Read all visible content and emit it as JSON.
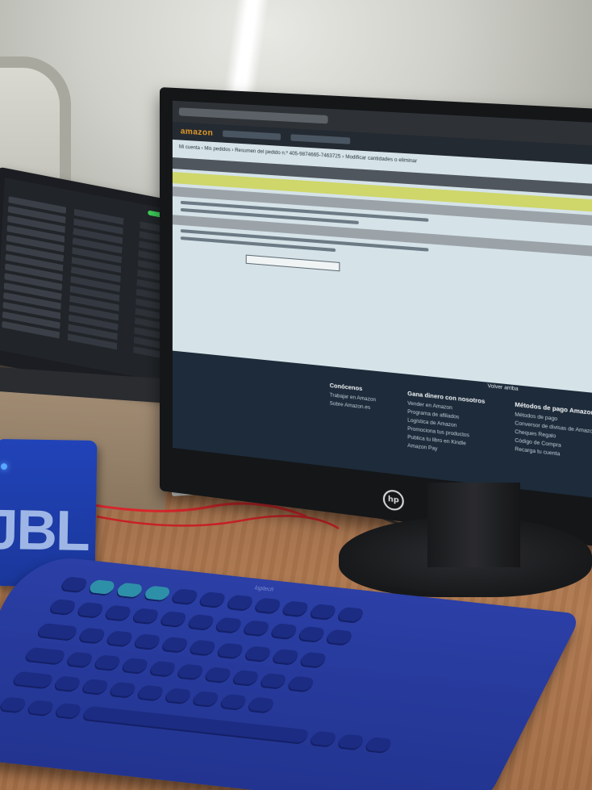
{
  "monitor": {
    "site_brand": "amazon",
    "breadcrumb": "Mi cuenta › Mis pedidos › Resumen del pedido n.º 405-9874665-7463725 › Modificar cantidades o eliminar",
    "back_to_top": "Volver arriba",
    "footer": {
      "columns": [
        {
          "heading": "Conócenos",
          "links": [
            "Trabajar en Amazon",
            "Sobre Amazon.es"
          ]
        },
        {
          "heading": "Gana dinero con nosotros",
          "links": [
            "Vender en Amazon",
            "Programa de afiliados",
            "Logística de Amazon",
            "Promociona tus productos",
            "Publica tu libro en Kindle",
            "Amazon Pay"
          ]
        },
        {
          "heading": "Métodos de pago Amazon",
          "links": [
            "Métodos de pago",
            "Conversor de divisas de Amazon",
            "Cheques Regalo",
            "Código de Compra",
            "Recarga tu cuenta"
          ]
        }
      ]
    },
    "hardware_logo": "hp"
  },
  "speaker": {
    "logo": "JBL",
    "led_color": "#58a6ff"
  },
  "keyboard": {
    "brand": "logitech"
  },
  "colors": {
    "keyboard_blue": "#2b3fa6",
    "speaker_blue": "#2143b8",
    "laptop_indicator": "#3fd05a",
    "amazon_orange": "#e39a2b"
  }
}
